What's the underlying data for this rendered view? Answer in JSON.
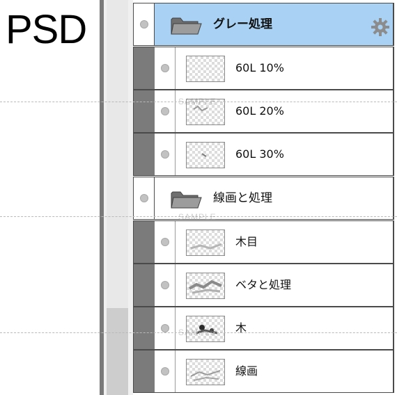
{
  "left_label": "PSD",
  "watermark": "SAMPLE",
  "colors": {
    "selected_row": "#a8d1f3",
    "indent_bar": "#7b7b7b",
    "pane_divider": "#7a7a7a",
    "row_border": "#4a4a4a"
  },
  "layers": {
    "group1": {
      "name": "グレー処理",
      "icon": "folder-icon",
      "selected": true
    },
    "group1_children": [
      {
        "name": "60L 10%",
        "icon": "layer-thumbnail"
      },
      {
        "name": "60L 20%",
        "icon": "layer-thumbnail"
      },
      {
        "name": "60L 30%",
        "icon": "layer-thumbnail"
      }
    ],
    "group2": {
      "name": "線画と処理",
      "icon": "folder-icon",
      "selected": false
    },
    "group2_children": [
      {
        "name": "木目",
        "icon": "layer-thumbnail"
      },
      {
        "name": "ベタと処理",
        "icon": "layer-thumbnail"
      },
      {
        "name": "木",
        "icon": "layer-thumbnail"
      },
      {
        "name": "線画",
        "icon": "layer-thumbnail"
      }
    ]
  }
}
